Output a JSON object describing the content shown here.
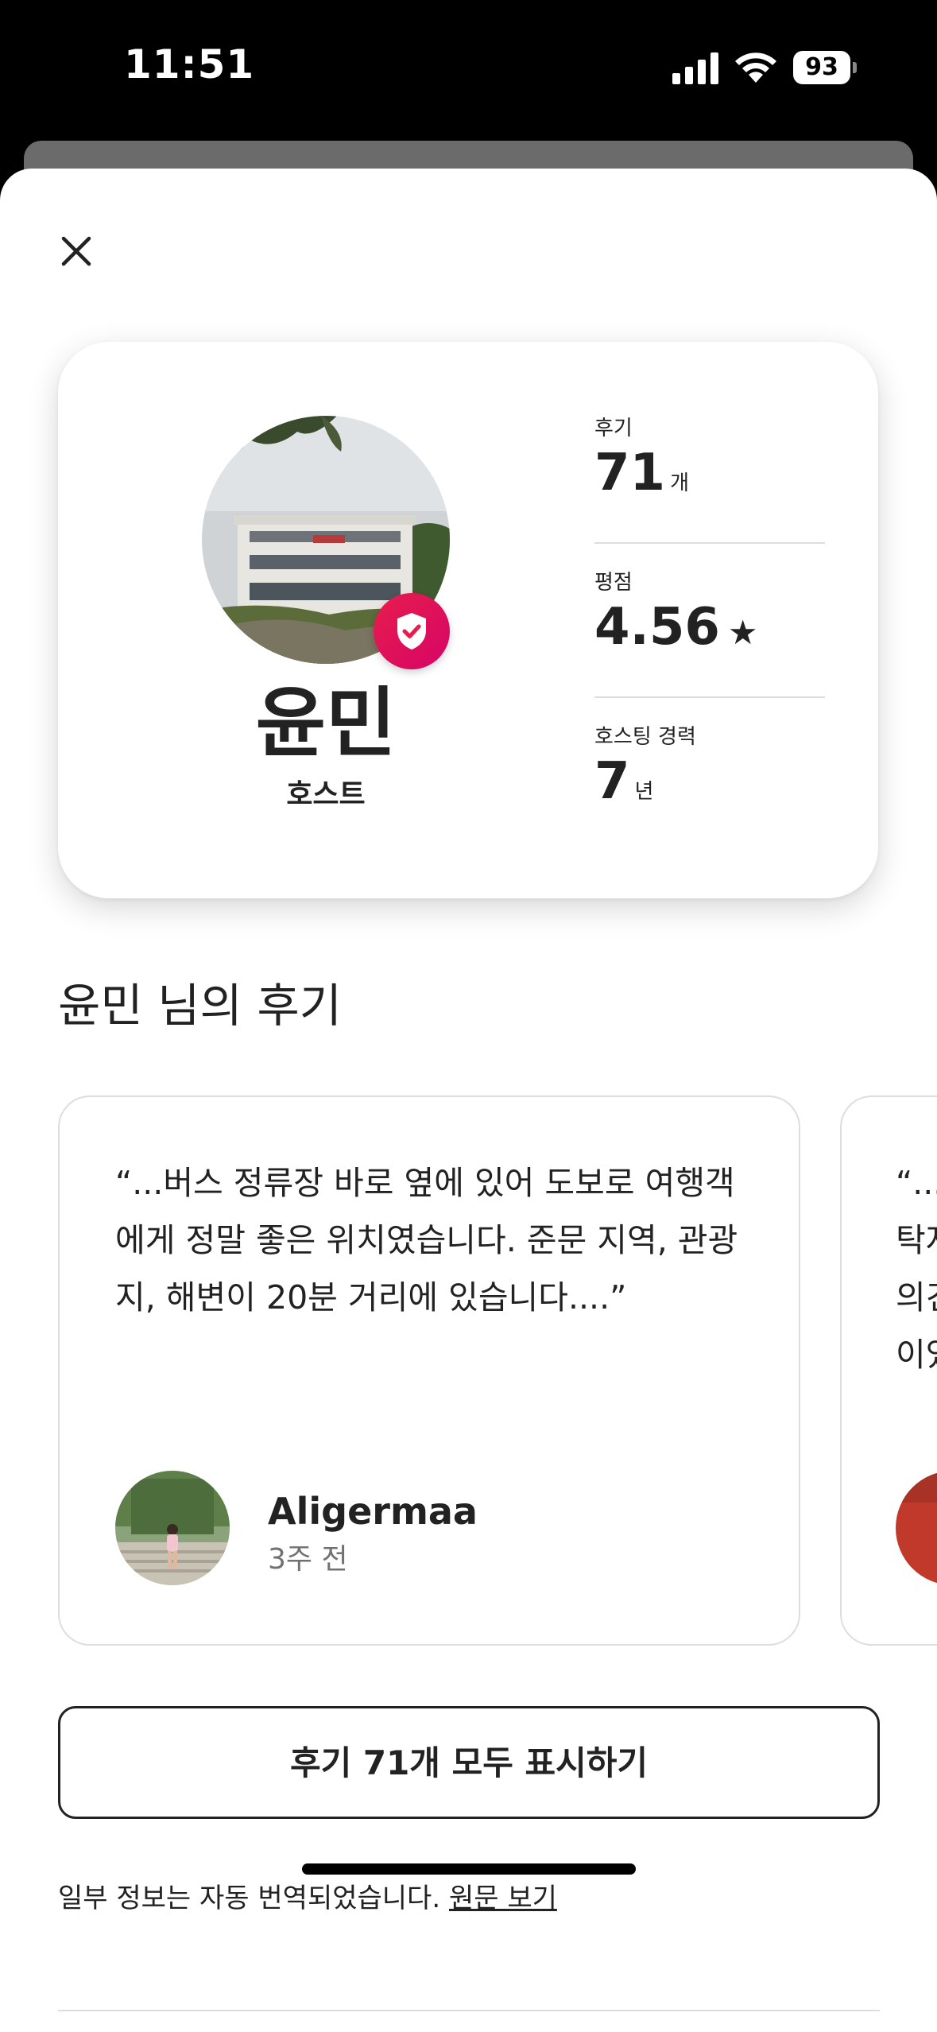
{
  "status_bar": {
    "time": "11:51",
    "battery": "93",
    "icons": [
      "signal-icon",
      "wifi-icon",
      "battery-icon"
    ]
  },
  "close_icon": "close-icon",
  "host": {
    "name": "윤민",
    "role": "호스트",
    "verified_icon": "shield-check-icon",
    "stats": [
      {
        "label": "후기",
        "value": "71",
        "unit": "개"
      },
      {
        "label": "평점",
        "value": "4.56",
        "unit": "★"
      },
      {
        "label": "호스팅 경력",
        "value": "7",
        "unit": "년"
      }
    ]
  },
  "reviews_section": {
    "title": "윤민 님의 후기",
    "reviews": [
      {
        "text": "“...버스 정류장 바로 옆에 있어 도보로 여행객에게 정말 좋은 위치였습니다. 준문 지역, 관광지, 해변이 20분 거리에 있습니다....”",
        "reviewer": "Aligermaa",
        "date": "3주 전"
      },
      {
        "text_lines": [
          "“...",
          "탁자",
          "의견",
          "이었"
        ]
      }
    ],
    "show_all_label": "후기 71개 모두 표시하기"
  },
  "translation": {
    "note": "일부 정보는 자동 번역되었습니다.",
    "link": "원문 보기"
  },
  "colors": {
    "brand": "#e61e4d",
    "text": "#222222",
    "muted": "#717171",
    "border": "#dddddd"
  }
}
